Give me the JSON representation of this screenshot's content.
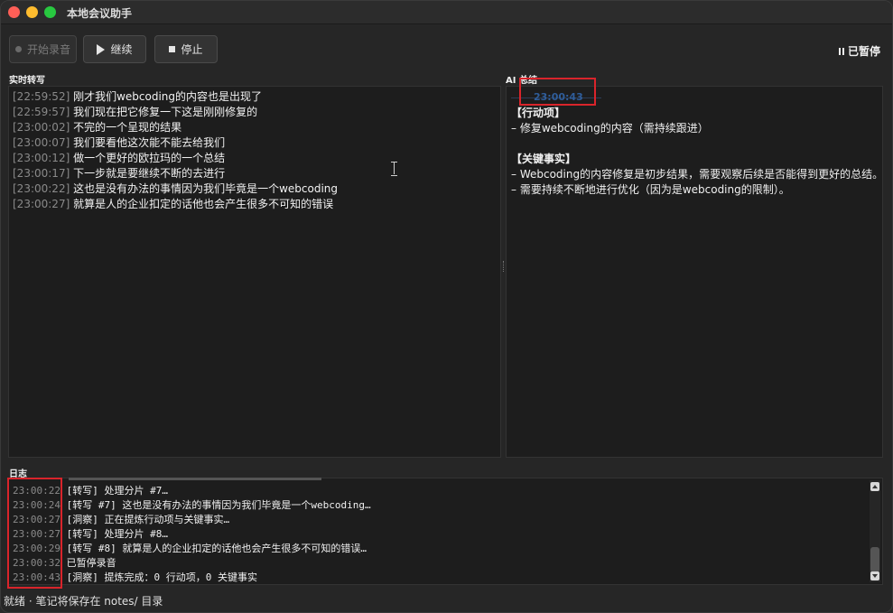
{
  "window": {
    "title": "本地会议助手"
  },
  "toolbar": {
    "start_label": "开始录音",
    "continue_label": "继续",
    "stop_label": "停止",
    "status_text": "已暂停"
  },
  "transcript": {
    "label": "实时转写",
    "lines": [
      {
        "time": "[22:59:52]",
        "text": "刚才我们webcoding的内容也是出现了"
      },
      {
        "time": "[22:59:57]",
        "text": "我们现在把它修复一下这是刚刚修复的"
      },
      {
        "time": "[23:00:02]",
        "text": "不完的一个呈现的结果"
      },
      {
        "time": "[23:00:07]",
        "text": "我们要看他这次能不能去给我们"
      },
      {
        "time": "[23:00:12]",
        "text": "做一个更好的欧拉玛的一个总结"
      },
      {
        "time": "[23:00:17]",
        "text": "下一步就是要继续不断的去进行"
      },
      {
        "time": "[23:00:22]",
        "text": "这也是没有办法的事情因为我们毕竟是一个webcoding"
      },
      {
        "time": "[23:00:27]",
        "text": "就算是人的企业扣定的话他也会产生很多不可知的错误"
      }
    ]
  },
  "ai": {
    "label": "AI 总结",
    "timestamp": "23:00:43",
    "action_heading": "【行动项】",
    "action_items": [
      "– 修复webcoding的内容（需持续跟进）"
    ],
    "facts_heading": "【关键事实】",
    "facts": [
      "– Webcoding的内容修复是初步结果，需要观察后续是否能得到更好的总结。",
      "– 需要持续不断地进行优化（因为是webcoding的限制）。"
    ]
  },
  "log": {
    "label": "日志",
    "lines": [
      {
        "time": "23:00:22",
        "text": "[转写] 处理分片 #7…"
      },
      {
        "time": "23:00:24",
        "text": "[转写 #7] 这也是没有办法的事情因为我们毕竟是一个webcoding…"
      },
      {
        "time": "23:00:27",
        "text": "[洞察] 正在提炼行动项与关键事实…"
      },
      {
        "time": "23:00:27",
        "text": "[转写] 处理分片 #8…"
      },
      {
        "time": "23:00:29",
        "text": "[转写 #8] 就算是人的企业扣定的话他也会产生很多不可知的错误…"
      },
      {
        "time": "23:00:32",
        "text": "已暂停录音"
      },
      {
        "time": "23:00:43",
        "text": "[洞察] 提炼完成：0 行动项，0 关键事实"
      }
    ]
  },
  "statusbar": {
    "text": "就绪 · 笔记将保存在 notes/ 目录"
  },
  "colors": {
    "highlight": "#d9242b",
    "ai_timestamp": "#2f5d9a",
    "background": "#262626"
  }
}
